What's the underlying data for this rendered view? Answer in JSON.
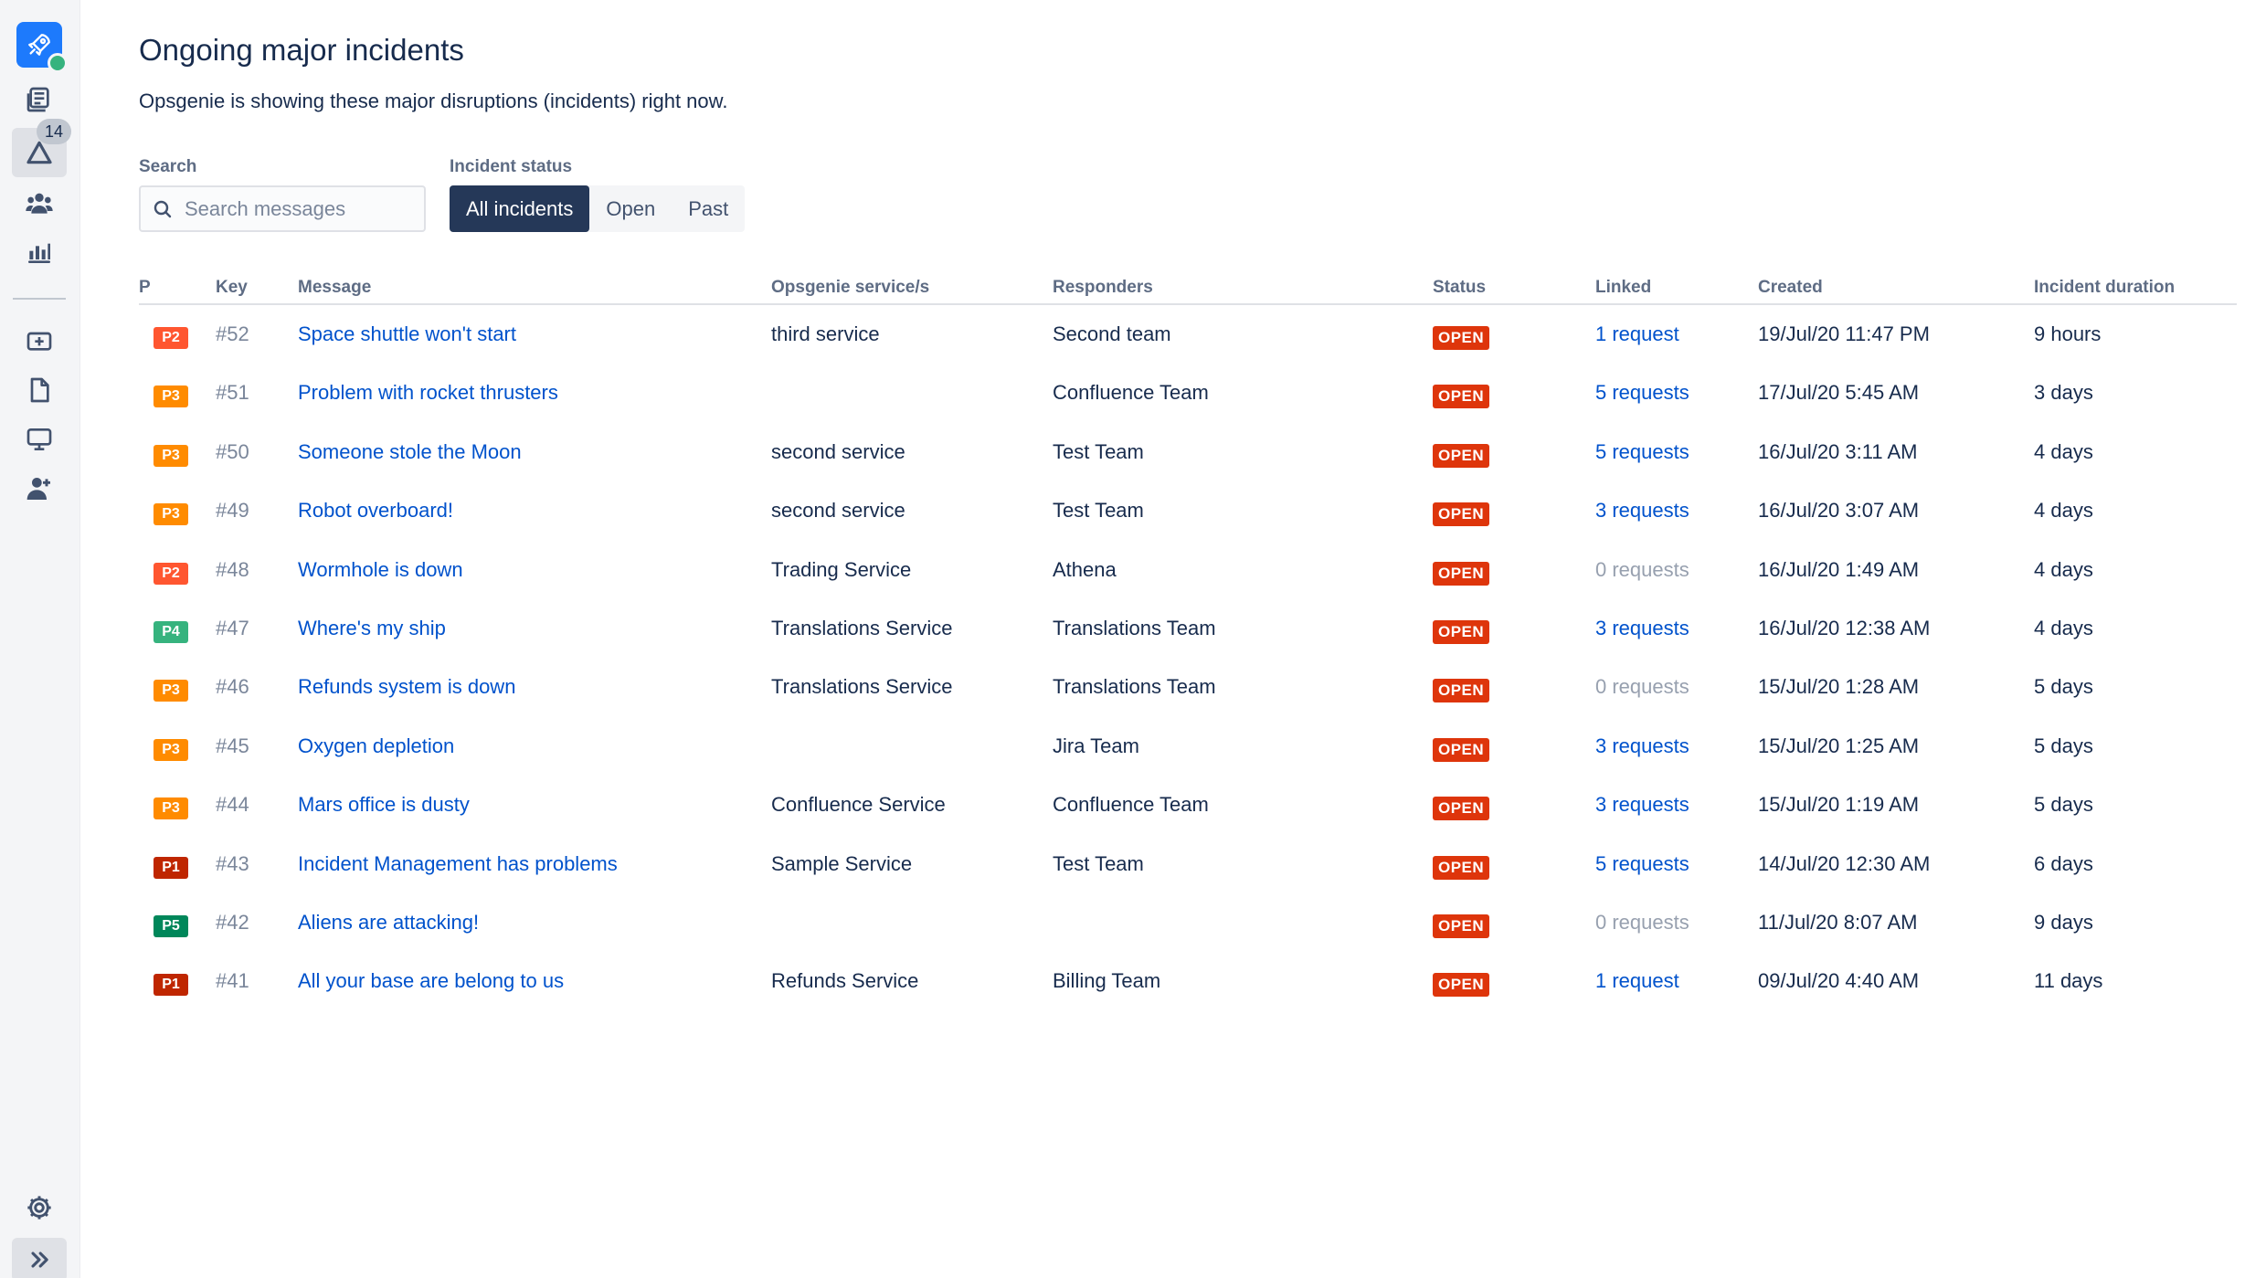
{
  "sidebar": {
    "notification_count": "14",
    "colors": {
      "background": "#f4f5f7",
      "logo": "#1d7afc",
      "logo_badge": "#36b37e"
    }
  },
  "page": {
    "title": "Ongoing major incidents",
    "description": "Opsgenie is showing these major disruptions (incidents) right now."
  },
  "search": {
    "label": "Search",
    "placeholder": "Search messages"
  },
  "status_filter": {
    "label": "Incident status",
    "options": [
      "All incidents",
      "Open",
      "Past"
    ],
    "selected": "All incidents"
  },
  "table": {
    "headers": {
      "p": "P",
      "key": "Key",
      "message": "Message",
      "service": "Opsgenie service/s",
      "responders": "Responders",
      "status": "Status",
      "linked": "Linked",
      "created": "Created",
      "duration": "Incident duration"
    },
    "rows": [
      {
        "priority": "P2",
        "key": "#52",
        "message": "Space shuttle won't start",
        "service": "third service",
        "responders": "Second team",
        "status": "OPEN",
        "linked": "1 request",
        "created": "19/Jul/20 11:47 PM",
        "duration": "9 hours"
      },
      {
        "priority": "P3",
        "key": "#51",
        "message": "Problem with rocket thrusters",
        "service": "",
        "responders": "Confluence Team",
        "status": "OPEN",
        "linked": "5 requests",
        "created": "17/Jul/20 5:45 AM",
        "duration": "3 days"
      },
      {
        "priority": "P3",
        "key": "#50",
        "message": "Someone stole the Moon",
        "service": "second service",
        "responders": "Test Team",
        "status": "OPEN",
        "linked": "5 requests",
        "created": "16/Jul/20 3:11 AM",
        "duration": "4 days"
      },
      {
        "priority": "P3",
        "key": "#49",
        "message": "Robot overboard!",
        "service": "second service",
        "responders": "Test Team",
        "status": "OPEN",
        "linked": "3 requests",
        "created": "16/Jul/20 3:07 AM",
        "duration": "4 days"
      },
      {
        "priority": "P2",
        "key": "#48",
        "message": "Wormhole is down",
        "service": "Trading Service",
        "responders": "Athena",
        "status": "OPEN",
        "linked": "0 requests",
        "created": "16/Jul/20 1:49 AM",
        "duration": "4 days"
      },
      {
        "priority": "P4",
        "key": "#47",
        "message": "Where's my ship",
        "service": "Translations Service",
        "responders": "Translations Team",
        "status": "OPEN",
        "linked": "3 requests",
        "created": "16/Jul/20 12:38 AM",
        "duration": "4 days"
      },
      {
        "priority": "P3",
        "key": "#46",
        "message": "Refunds system is down",
        "service": "Translations Service",
        "responders": "Translations Team",
        "status": "OPEN",
        "linked": "0 requests",
        "created": "15/Jul/20 1:28 AM",
        "duration": "5 days"
      },
      {
        "priority": "P3",
        "key": "#45",
        "message": "Oxygen depletion",
        "service": "",
        "responders": "Jira Team",
        "status": "OPEN",
        "linked": "3 requests",
        "created": "15/Jul/20 1:25 AM",
        "duration": "5 days"
      },
      {
        "priority": "P3",
        "key": "#44",
        "message": "Mars office is dusty",
        "service": "Confluence Service",
        "responders": "Confluence Team",
        "status": "OPEN",
        "linked": "3 requests",
        "created": "15/Jul/20 1:19 AM",
        "duration": "5 days"
      },
      {
        "priority": "P1",
        "key": "#43",
        "message": "Incident Management has problems",
        "service": "Sample Service",
        "responders": "Test Team",
        "status": "OPEN",
        "linked": "5 requests",
        "created": "14/Jul/20 12:30 AM",
        "duration": "6 days"
      },
      {
        "priority": "P5",
        "key": "#42",
        "message": "Aliens are attacking!",
        "service": "",
        "responders": "",
        "status": "OPEN",
        "linked": "0 requests",
        "created": "11/Jul/20 8:07 AM",
        "duration": "9 days"
      },
      {
        "priority": "P1",
        "key": "#41",
        "message": "All your base are belong to us",
        "service": "Refunds Service",
        "responders": "Billing Team",
        "status": "OPEN",
        "linked": "1 request",
        "created": "09/Jul/20 4:40 AM",
        "duration": "11 days"
      }
    ]
  },
  "priority_colors": {
    "P1": "#bf2600",
    "P2": "#ff5630",
    "P3": "#ff8b00",
    "P4": "#36b37e",
    "P5": "#00875a"
  },
  "status_color": "#de350b",
  "link_color": "#0052cc",
  "selected_filter_color": "#253858"
}
